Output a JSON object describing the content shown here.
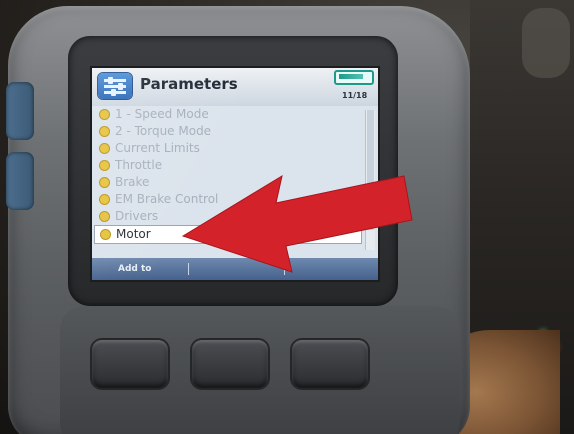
{
  "screen": {
    "title": "Parameters",
    "page_counter": "11/18",
    "items": [
      {
        "label": "1 - Speed Mode"
      },
      {
        "label": "2 - Torque Mode"
      },
      {
        "label": "Current Limits"
      },
      {
        "label": "Throttle"
      },
      {
        "label": "Brake"
      },
      {
        "label": "EM Brake Control"
      },
      {
        "label": "Drivers"
      },
      {
        "label": "Motor"
      }
    ],
    "selected_item": "Motor",
    "soft_keys": [
      "Add to",
      "",
      ""
    ]
  },
  "colors": {
    "arrow": "#d3222a",
    "bullet": "#e6c33c",
    "soft_bar": "#5574a0"
  },
  "icons": {
    "app": "parameters-sliders-icon",
    "status": "connection-status-icon",
    "annotation": "red-arrow"
  }
}
